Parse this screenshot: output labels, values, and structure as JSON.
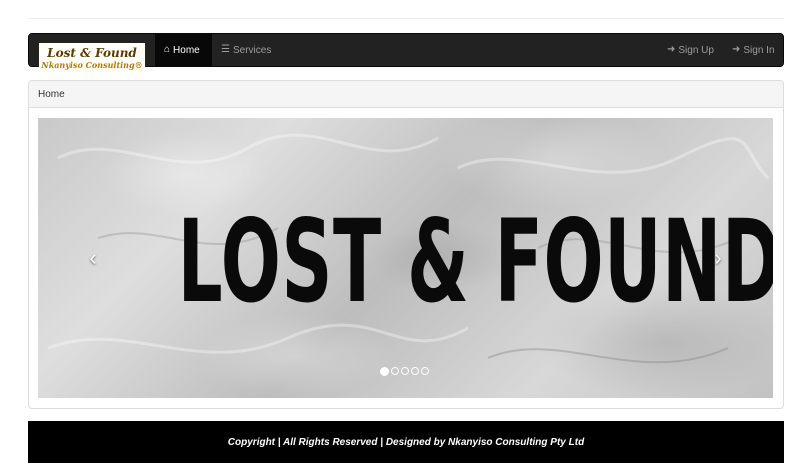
{
  "navbar": {
    "brand_title": "Lost & Found",
    "brand_subtitle": "Nkanyiso Consulting®",
    "items": [
      {
        "label": "Home",
        "icon": "home-icon",
        "active": true
      },
      {
        "label": "Services",
        "icon": "list-icon",
        "active": false
      }
    ],
    "right_items": [
      {
        "label": "Sign Up",
        "icon": "sign-in-icon"
      },
      {
        "label": "Sign In",
        "icon": "sign-in-icon"
      }
    ]
  },
  "breadcrumb": {
    "current": "Home"
  },
  "carousel": {
    "slide_text": "LOST & FOUND",
    "slide_count": 5,
    "active_slide": 1,
    "prev_icon": "chevron-left-icon",
    "next_icon": "chevron-right-icon"
  },
  "footer": {
    "text": "Copyright | All Rights Reserved | Designed by Nkanyiso Consulting Pty Ltd"
  },
  "colors": {
    "navbar_bg": "#222222",
    "active_nav_bg": "#080808",
    "footer_bg": "#000000",
    "brand_title": "#5a3a00",
    "brand_subtitle": "#b07a00"
  }
}
